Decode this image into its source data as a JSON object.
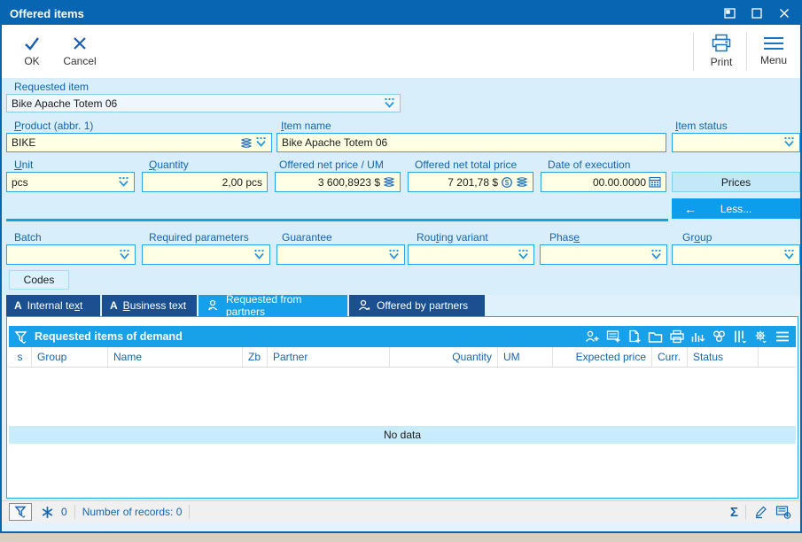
{
  "colors": {
    "accent": "#14a0ea",
    "titlebar": "#0865b2",
    "navy_tab": "#1a4f90",
    "field_yellow": "#ffffe3",
    "field_border": "#2aa4e8",
    "caption_bar": "#18a0e8",
    "label_blue": "#1565b0"
  },
  "window": {
    "title": "Offered items",
    "controls": [
      "dock",
      "maximize",
      "close"
    ]
  },
  "toolbar": {
    "ok_label": "OK",
    "cancel_label": "Cancel",
    "print_label": "Print",
    "menu_label": "Menu"
  },
  "form": {
    "requested_item": {
      "label": "Requested item",
      "value": "Bike Apache Totem 06"
    },
    "product": {
      "label": {
        "text": "Product (abbr. 1)",
        "ul": 0
      },
      "value": "BIKE"
    },
    "item_name": {
      "label": {
        "text": "Item name",
        "ul": 0
      },
      "value": "Bike Apache Totem 06"
    },
    "item_status": {
      "label": {
        "text": "Item status",
        "ul": 0
      },
      "value": ""
    },
    "unit": {
      "label": {
        "text": "Unit",
        "ul": 0
      },
      "value": "pcs"
    },
    "quantity": {
      "label": {
        "text": "Quantity",
        "ul": 0
      },
      "value": "2,00 pcs"
    },
    "offered_net_price": {
      "label": "Offered net price / UM",
      "value": "3 600,8923 $"
    },
    "offered_net_total_price": {
      "label": "Offered net total price",
      "value": "7 201,78 $"
    },
    "date_of_execution": {
      "label": "Date of execution",
      "value": "00.00.0000"
    },
    "prices_button": "Prices",
    "less_button": "Less...",
    "batch": {
      "label": "Batch",
      "value": ""
    },
    "required_parameters": {
      "label": "Required parameters",
      "value": ""
    },
    "guarantee": {
      "label": "Guarantee",
      "value": ""
    },
    "routing_variant": {
      "label": {
        "text": "Routing variant",
        "ul": 3
      },
      "value": ""
    },
    "phase": {
      "label": {
        "text": "Phase",
        "ul": 4
      },
      "value": ""
    },
    "group": {
      "label": {
        "text": "Group",
        "ul": 2
      },
      "value": ""
    },
    "codes_button": "Codes"
  },
  "tabs": [
    {
      "label": {
        "text": "Internal text",
        "ul": 11
      },
      "icon": "letter-a",
      "active": false
    },
    {
      "label": {
        "text": "Business text",
        "ul": 0
      },
      "icon": "letter-a",
      "active": false
    },
    {
      "label": "Requested from partners",
      "icon": "person-arrow-left",
      "active": true
    },
    {
      "label": "Offered by partners",
      "icon": "person-arrow-right",
      "active": false
    }
  ],
  "table": {
    "caption": "Requested items of demand",
    "caption_icon": "filter-icon",
    "toolbar_icons": [
      "add-partner",
      "add-from-form",
      "add-document",
      "folder",
      "print",
      "export-chart",
      "related-items",
      "columns",
      "settings",
      "menu"
    ],
    "columns": [
      "s",
      "Group",
      "Name",
      "Zb",
      "Partner",
      "Quantity",
      "UM",
      "Expected price",
      "Curr.",
      "Status"
    ],
    "empty_text": "No data"
  },
  "statusbar": {
    "filter_icon": "filter-icon",
    "asterisk_icon": "asterisk-icon",
    "asterisk_count": "0",
    "records_label": "Number of records: 0",
    "right_icons": [
      "sum",
      "edit",
      "add-form"
    ],
    "sum_symbol": "Σ"
  }
}
